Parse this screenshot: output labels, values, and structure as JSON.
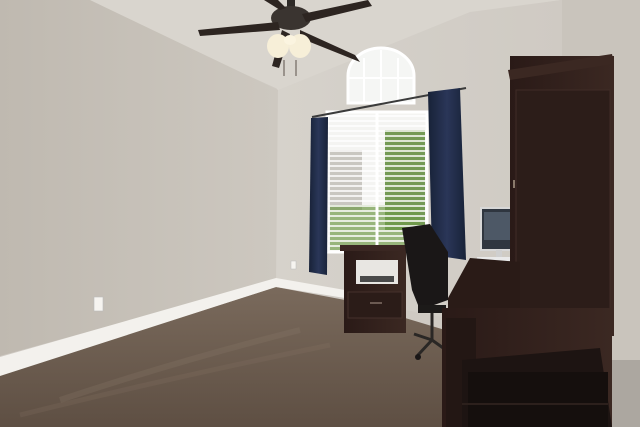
{
  "scene": {
    "subject": "home-office-room",
    "objects": [
      "ceiling-fan",
      "arched-window",
      "window-with-blinds",
      "navy-curtains",
      "printer-stand",
      "desk-chair",
      "computer-monitor",
      "desk-hutch",
      "carpet",
      "baseboard",
      "electrical-outlet"
    ]
  },
  "colors": {
    "wall_left": "#c9c4bc",
    "wall_back": "#d8d4cd",
    "ceiling": "#dcd8d2",
    "carpet": "#6e5d4f",
    "furniture": "#2f1f1b",
    "curtain": "#1f2a44",
    "baseboard": "#f2f0ec",
    "foliage": "#5d8a3a"
  }
}
